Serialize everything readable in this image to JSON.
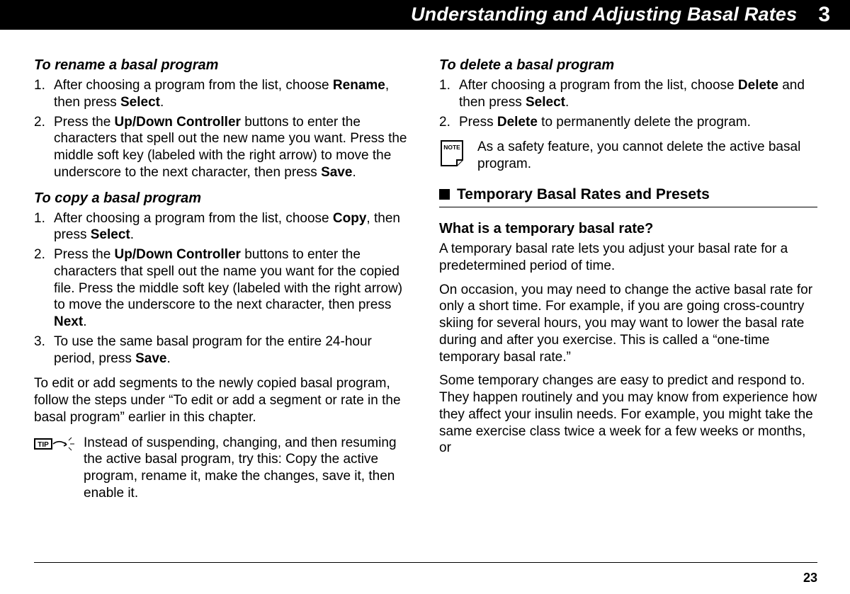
{
  "header": {
    "title": "Understanding and Adjusting Basal Rates",
    "chapter": "3"
  },
  "left": {
    "rename": {
      "heading": "To rename a basal program",
      "step1_a": "After choosing a program from the list, choose ",
      "step1_b": "Rename",
      "step1_c": ", then press ",
      "step1_d": "Select",
      "step1_e": ".",
      "step2_a": "Press the ",
      "step2_b": "Up/Down Controller",
      "step2_c": " buttons to enter the characters that spell out the new name you want. Press the middle soft key (labeled with the right arrow) to move the underscore to the next character, then press ",
      "step2_d": "Save",
      "step2_e": "."
    },
    "copy": {
      "heading": "To copy a basal program",
      "step1_a": "After choosing a program from the list, choose ",
      "step1_b": "Copy",
      "step1_c": ", then press ",
      "step1_d": "Select",
      "step1_e": ".",
      "step2_a": "Press the ",
      "step2_b": "Up/Down Controller",
      "step2_c": " buttons to enter the characters that spell out the name you want for the copied file. Press the middle soft key (labeled with the right arrow) to move the underscore to the next character, then press ",
      "step2_d": "Next",
      "step2_e": ".",
      "step3_a": "To use the same basal program for the entire 24-hour period, press ",
      "step3_b": "Save",
      "step3_c": ".",
      "followup": "To edit or add segments to the newly copied basal program, follow the steps under “To edit or add a segment or rate in the basal program” earlier in this chapter."
    },
    "tip": {
      "icon_label": "TIP",
      "text": "Instead of suspending, changing, and then resuming the active basal program, try this: Copy the active program, rename it, make the changes, save it, then enable it."
    }
  },
  "right": {
    "delete": {
      "heading": "To delete a basal program",
      "step1_a": "After choosing a program from the list, choose ",
      "step1_b": "Delete",
      "step1_c": " and then press ",
      "step1_d": "Select",
      "step1_e": ".",
      "step2_a": "Press ",
      "step2_b": "Delete",
      "step2_c": " to permanently delete the program."
    },
    "note": {
      "icon_label": "NOTE",
      "text": "As a safety feature, you cannot delete the active basal program."
    },
    "section": {
      "heading": "Temporary Basal Rates and Presets"
    },
    "temp": {
      "heading": "What is a temporary basal rate?",
      "p1": "A temporary basal rate lets you adjust your basal rate for a predetermined period of time.",
      "p2": "On occasion, you may need to change the active basal rate for only a short time. For example, if you are going cross-country skiing for several hours, you may want to lower the basal rate during and after you exercise. This is called a “one-time temporary basal rate.”",
      "p3": "Some temporary changes are easy to predict and respond to. They happen routinely and you may know from experience how they affect your insulin needs. For example, you might take the same exercise class twice a week for a few weeks or months, or"
    }
  },
  "page_number": "23"
}
